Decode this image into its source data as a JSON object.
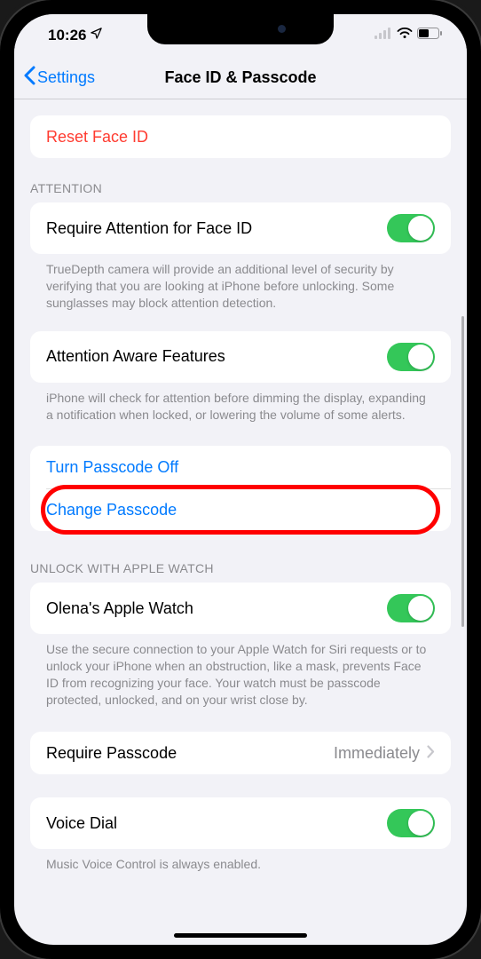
{
  "status": {
    "time": "10:26",
    "location_icon": "location-arrow"
  },
  "nav": {
    "back_label": "Settings",
    "title": "Face ID & Passcode"
  },
  "reset": {
    "label": "Reset Face ID"
  },
  "attention": {
    "header": "ATTENTION",
    "require": {
      "label": "Require Attention for Face ID",
      "on": true
    },
    "require_footer": "TrueDepth camera will provide an additional level of security by verifying that you are looking at iPhone before unlocking. Some sunglasses may block attention detection.",
    "aware": {
      "label": "Attention Aware Features",
      "on": true
    },
    "aware_footer": "iPhone will check for attention before dimming the display, expanding a notification when locked, or lowering the volume of some alerts."
  },
  "passcode": {
    "turn_off_label": "Turn Passcode Off",
    "change_label": "Change Passcode"
  },
  "apple_watch": {
    "header": "UNLOCK WITH APPLE WATCH",
    "item_label": "Olena's Apple Watch",
    "on": true,
    "footer": "Use the secure connection to your Apple Watch for Siri requests or to unlock your iPhone when an obstruction, like a mask, prevents Face ID from recognizing your face. Your watch must be passcode protected, unlocked, and on your wrist close by."
  },
  "require_passcode": {
    "label": "Require Passcode",
    "value": "Immediately"
  },
  "voice_dial": {
    "label": "Voice Dial",
    "on": true,
    "footer": "Music Voice Control is always enabled."
  }
}
